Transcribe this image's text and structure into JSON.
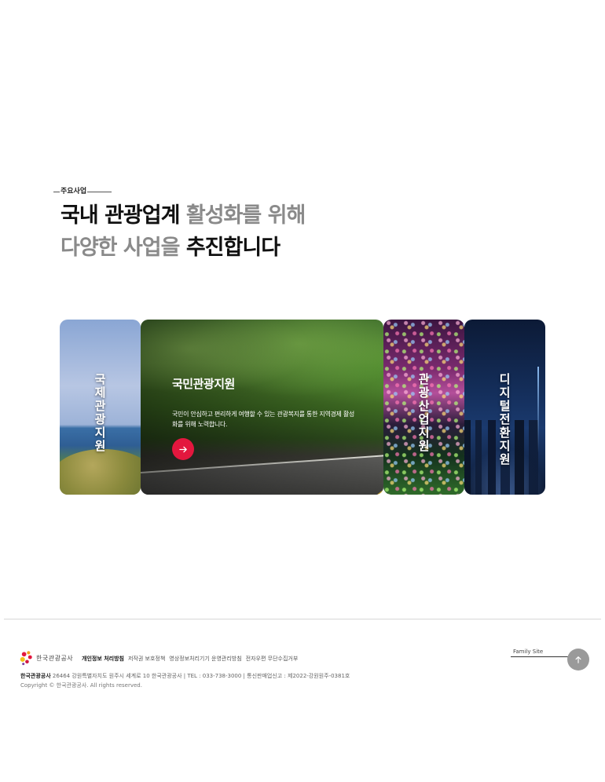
{
  "section": {
    "eyebrow": "주요사업",
    "headline_line1_dark": "국내 관광업계",
    "headline_line1_grey": " 활성화를 위해",
    "headline_line2_grey": "다양한 사업을 ",
    "headline_line2_dark": "추진합니다"
  },
  "cards": [
    {
      "title": "국제관광지원",
      "image": "seaside-coast"
    },
    {
      "title": "국민관광지원",
      "description": "국민이 안심하고 편리하게 여행할 수 있는 관광복지를 통한 지역경제 활성화를 위해 노력합니다.",
      "image": "forest-road",
      "active": true,
      "arrow_icon": "arrow-right-icon"
    },
    {
      "title": "관광산업지원",
      "image": "festival-lights"
    },
    {
      "title": "디지털전환지원",
      "image": "city-night"
    }
  ],
  "footer": {
    "logo_text": "한국관광공사",
    "links": [
      "개인정보 처리방침",
      "저작권 보호정책",
      "영상정보처리기기 운영관리방침",
      "전자우편 무단수집거부"
    ],
    "org_name": "한국관광공사",
    "address": " 26464 강원특별자치도 원주시 세계로 10 한국관광공사 | TEL : 033-738-3000 | 통신판매업신고 : 제2022-강원원주-0381호",
    "copyright": "Copyright © 한국관광공사. All rights reserved.",
    "family_site": "Family Site",
    "top_icon": "arrow-up-icon"
  },
  "colors": {
    "accent_red": "#e3173e",
    "headline_dark": "#111111",
    "headline_grey": "#8a8a8a",
    "top_button": "#9a9a9a"
  }
}
